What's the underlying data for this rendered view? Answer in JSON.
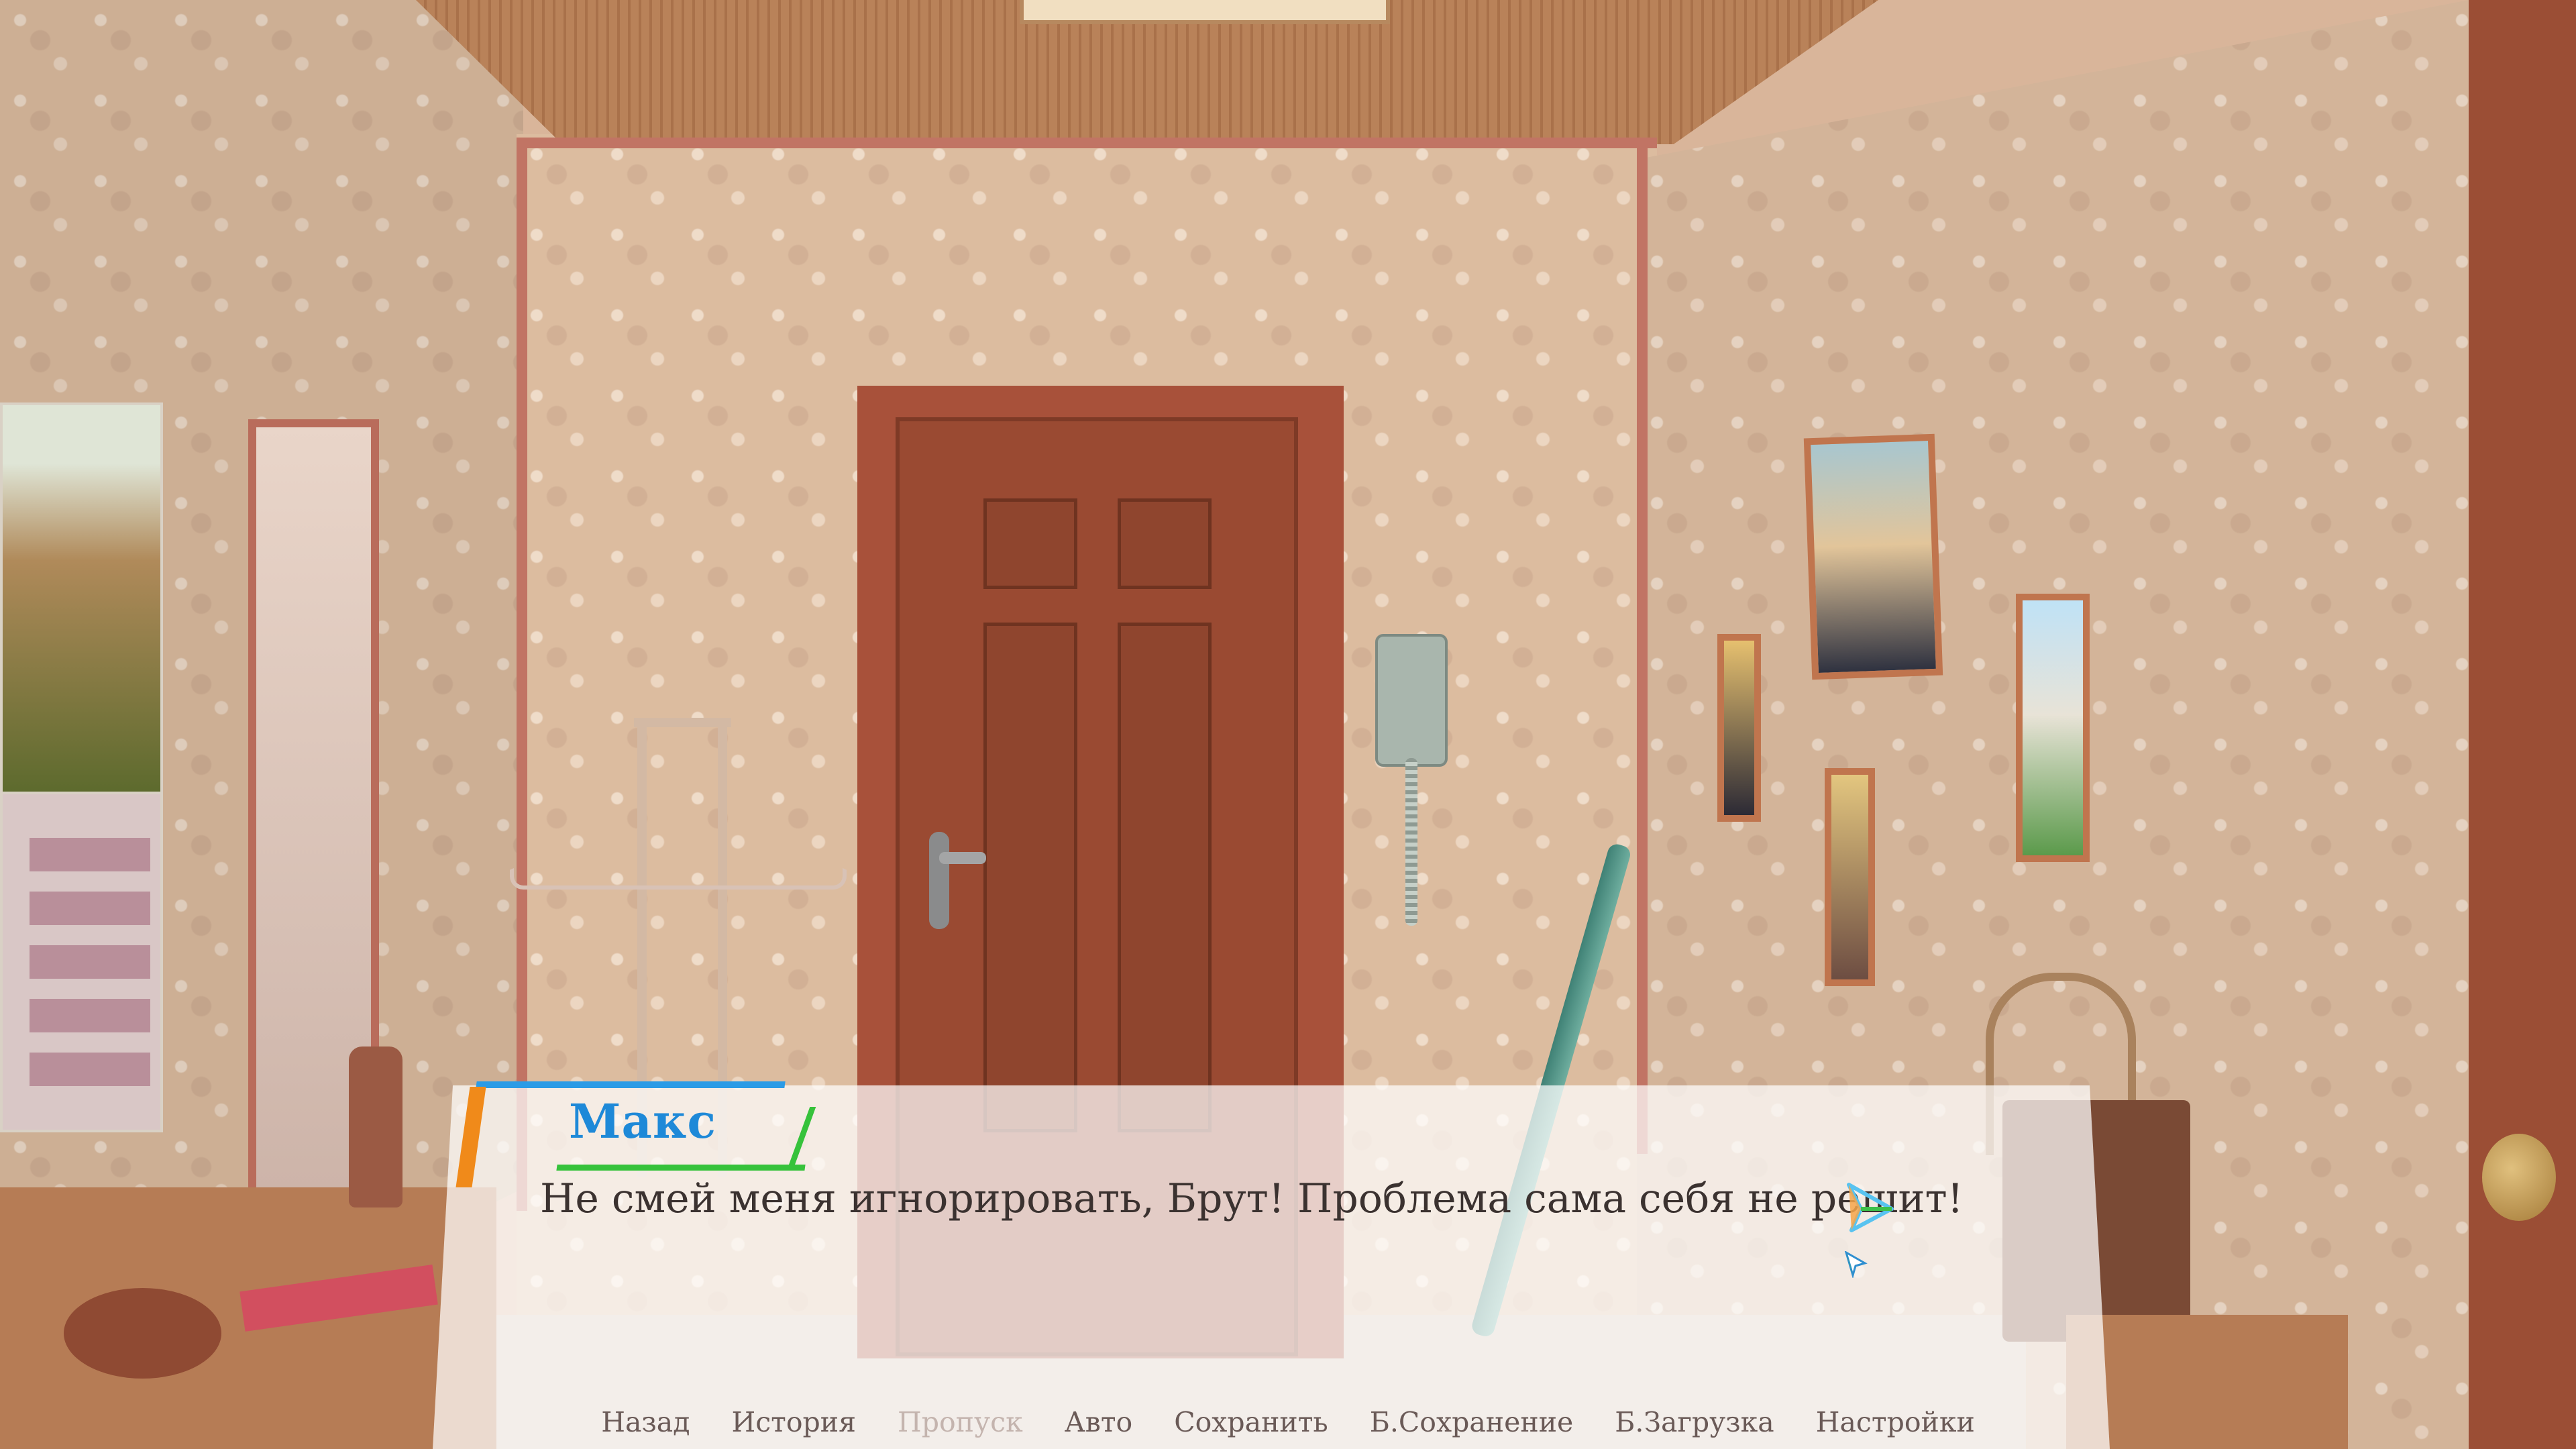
{
  "scene": {
    "background": "hallway",
    "icons": [
      "hallway-door",
      "intercom",
      "coat-rack",
      "umbrella",
      "handbag",
      "wall-pictures"
    ]
  },
  "dialogue": {
    "speaker": "Макс",
    "text": "Не смей меня игнорировать, Брут! Проблема сама себя не решит!",
    "name_color": "#1e89d8",
    "accent_colors": {
      "blue": "#2b9be6",
      "orange": "#f08a1a",
      "green": "#36c23b"
    },
    "ctc_icon": "paper-plane-icon"
  },
  "quick_menu": {
    "items": [
      {
        "label": "Назад",
        "enabled": true
      },
      {
        "label": "История",
        "enabled": true
      },
      {
        "label": "Пропуск",
        "enabled": false
      },
      {
        "label": "Авто",
        "enabled": true
      },
      {
        "label": "Сохранить",
        "enabled": true
      },
      {
        "label": "Б.Сохранение",
        "enabled": true
      },
      {
        "label": "Б.Загрузка",
        "enabled": true
      },
      {
        "label": "Настройки",
        "enabled": true
      }
    ]
  }
}
